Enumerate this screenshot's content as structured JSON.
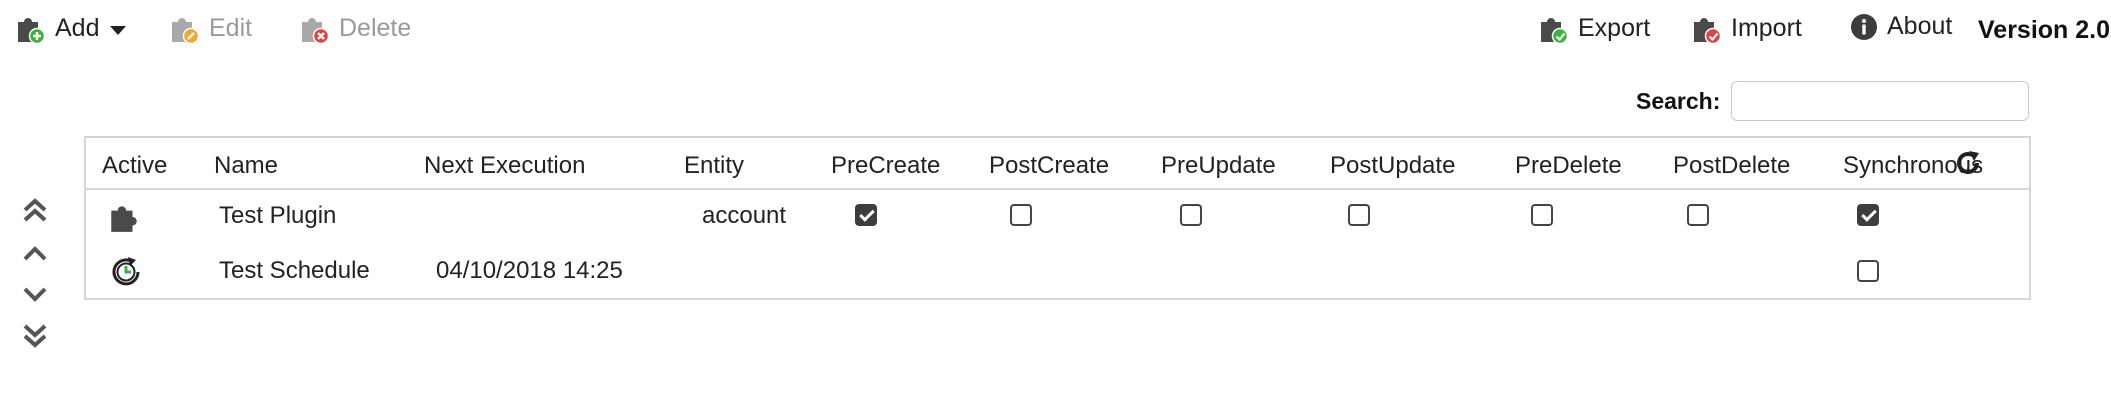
{
  "toolbar": {
    "add": {
      "label": "Add",
      "icon": "puzzle-add-icon"
    },
    "edit": {
      "label": "Edit",
      "icon": "puzzle-edit-icon",
      "enabled": false
    },
    "delete": {
      "label": "Delete",
      "icon": "puzzle-delete-icon",
      "enabled": false
    },
    "export": {
      "label": "Export",
      "icon": "puzzle-export-icon"
    },
    "import": {
      "label": "Import",
      "icon": "puzzle-import-icon"
    },
    "about": {
      "label": "About",
      "icon": "info-icon"
    }
  },
  "version": "Version 2.0",
  "search": {
    "label": "Search:",
    "value": "",
    "placeholder": ""
  },
  "grid": {
    "columns": [
      "Active",
      "Name",
      "Next Execution",
      "Entity",
      "PreCreate",
      "PostCreate",
      "PreUpdate",
      "PostUpdate",
      "PreDelete",
      "PostDelete",
      "Synchronous"
    ],
    "rows": [
      {
        "type_icon": "puzzle-icon",
        "name": "Test Plugin",
        "next_execution": "",
        "entity": "account",
        "precreate": true,
        "postcreate": false,
        "preupdate": false,
        "postupdate": false,
        "predelete": false,
        "postdelete": false,
        "synchronous": true
      },
      {
        "type_icon": "schedule-clock-icon",
        "name": "Test Schedule",
        "next_execution": "04/10/2018 14:25",
        "entity": "",
        "precreate": null,
        "postcreate": null,
        "preupdate": null,
        "postupdate": null,
        "predelete": null,
        "postdelete": null,
        "synchronous": false
      }
    ]
  },
  "colors": {
    "accent_green": "#3cb43c",
    "edit_orange": "#f0a830",
    "delete_red": "#e04040",
    "icon_dark": "#3d3d3d",
    "disabled": "#9a9a9a"
  }
}
